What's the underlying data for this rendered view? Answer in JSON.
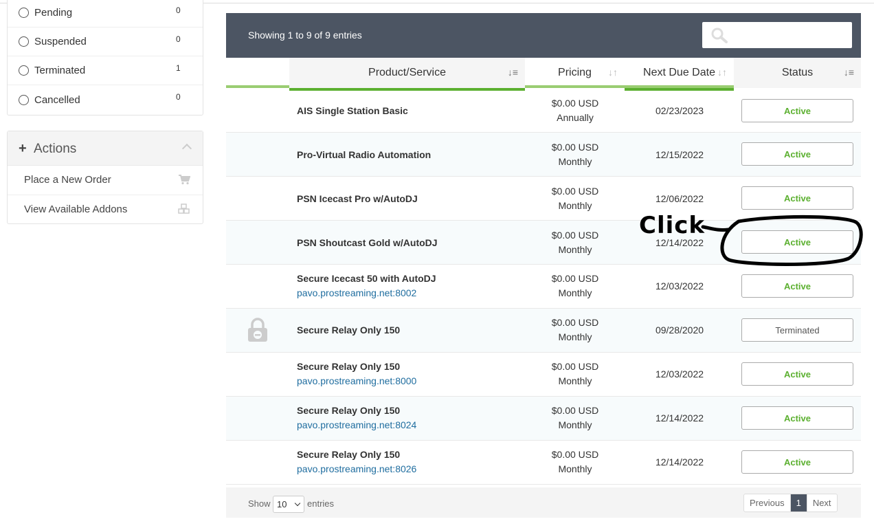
{
  "status_filter": {
    "items": [
      {
        "label": "Pending",
        "count": "0"
      },
      {
        "label": "Suspended",
        "count": "0"
      },
      {
        "label": "Terminated",
        "count": "1"
      },
      {
        "label": "Cancelled",
        "count": "0"
      }
    ]
  },
  "actions": {
    "title": "Actions",
    "items": [
      {
        "label": "Place a New Order",
        "icon": "cart-icon"
      },
      {
        "label": "View Available Addons",
        "icon": "cubes-icon"
      }
    ]
  },
  "table": {
    "showing": "Showing 1 to 9 of 9 entries",
    "search_placeholder": "",
    "columns": [
      "Product/Service",
      "Pricing",
      "Next Due Date",
      "Status"
    ],
    "rows": [
      {
        "name": "AIS Single Station Basic",
        "domain": "",
        "price": "$0.00 USD",
        "cycle": "Annually",
        "due": "02/23/2023",
        "status": "Active"
      },
      {
        "name": "Pro-Virtual Radio Automation",
        "domain": "",
        "price": "$0.00 USD",
        "cycle": "Monthly",
        "due": "12/15/2022",
        "status": "Active"
      },
      {
        "name": "PSN Icecast Pro w/AutoDJ",
        "domain": "",
        "price": "$0.00 USD",
        "cycle": "Monthly",
        "due": "12/06/2022",
        "status": "Active"
      },
      {
        "name": "PSN Shoutcast Gold w/AutoDJ",
        "domain": "",
        "price": "$0.00 USD",
        "cycle": "Monthly",
        "due": "12/14/2022",
        "status": "Active"
      },
      {
        "name": "Secure Icecast 50 with AutoDJ",
        "domain": "pavo.prostreaming.net:8002",
        "price": "$0.00 USD",
        "cycle": "Monthly",
        "due": "12/03/2022",
        "status": "Active"
      },
      {
        "name": "Secure Relay Only 150",
        "domain": "",
        "price": "$0.00 USD",
        "cycle": "Monthly",
        "due": "09/28/2020",
        "status": "Terminated"
      },
      {
        "name": "Secure Relay Only 150",
        "domain": "pavo.prostreaming.net:8000",
        "price": "$0.00 USD",
        "cycle": "Monthly",
        "due": "12/03/2022",
        "status": "Active"
      },
      {
        "name": "Secure Relay Only 150",
        "domain": "pavo.prostreaming.net:8024",
        "price": "$0.00 USD",
        "cycle": "Monthly",
        "due": "12/14/2022",
        "status": "Active"
      },
      {
        "name": "Secure Relay Only 150",
        "domain": "pavo.prostreaming.net:8026",
        "price": "$0.00 USD",
        "cycle": "Monthly",
        "due": "12/14/2022",
        "status": "Active"
      }
    ]
  },
  "footer": {
    "show_label": "Show",
    "page_size": "10",
    "entries_label": "entries",
    "prev": "Previous",
    "current_page": "1",
    "next": "Next"
  },
  "annotation": {
    "text": "Click"
  },
  "colors": {
    "header_bg": "#4c5563",
    "active_green": "#5cb030",
    "link_blue": "#1f6d9f",
    "sort_underline": "#9acd72"
  }
}
